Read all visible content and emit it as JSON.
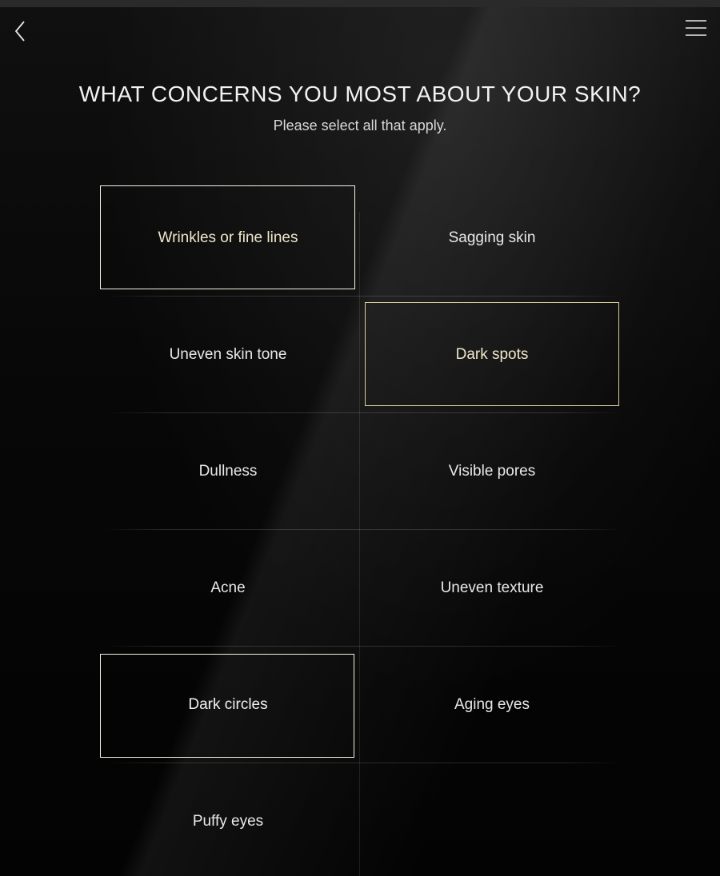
{
  "nav": {
    "back_icon": "chevron-left-icon",
    "menu_icon": "hamburger-menu-icon"
  },
  "header": {
    "title": "WHAT CONCERNS YOU MOST ABOUT YOUR SKIN?",
    "subtitle": "Please select all that apply."
  },
  "colors": {
    "background": "#000000",
    "selected_border_light": "#f4f0e2",
    "selected_border_gold": "#d7cc9a",
    "text": "#e8e8e8"
  },
  "options": [
    {
      "label": "Wrinkles or fine lines",
      "selected": true
    },
    {
      "label": "Sagging skin",
      "selected": false
    },
    {
      "label": "Uneven skin tone",
      "selected": false
    },
    {
      "label": "Dark spots",
      "selected": true
    },
    {
      "label": "Dullness",
      "selected": false
    },
    {
      "label": "Visible pores",
      "selected": false
    },
    {
      "label": "Acne",
      "selected": false
    },
    {
      "label": "Uneven texture",
      "selected": false
    },
    {
      "label": "Dark circles",
      "selected": true
    },
    {
      "label": "Aging eyes",
      "selected": false
    },
    {
      "label": "Puffy eyes",
      "selected": false
    }
  ]
}
